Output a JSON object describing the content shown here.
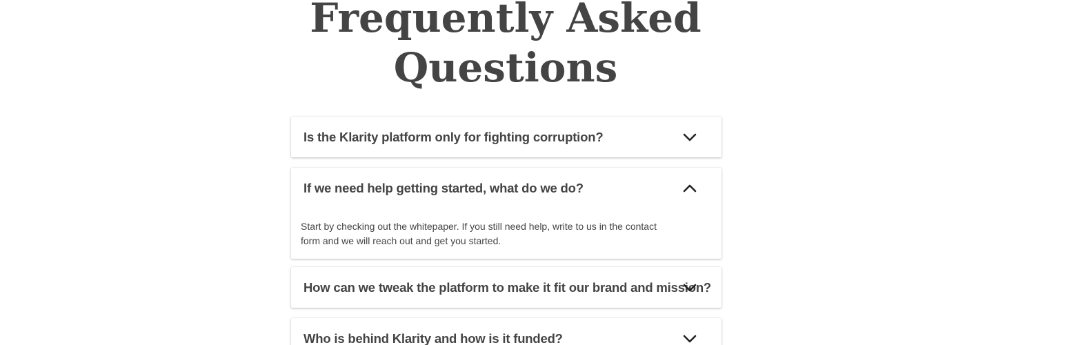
{
  "heading": {
    "line1": "Frequently Asked",
    "line2": "Questions"
  },
  "faqs": [
    {
      "question": "Is the Klarity platform only for fighting corruption?",
      "expanded": false,
      "toggle_icon": "chevron-down-icon"
    },
    {
      "question": "If we need help getting started, what do we do?",
      "answer": "Start by checking out the whitepaper. If you still need help, write to us in the contact form and we will reach out and get you started.",
      "expanded": true,
      "toggle_icon": "chevron-up-icon"
    },
    {
      "question": "How can we tweak the platform to make it fit our brand and mission?",
      "expanded": false,
      "toggle_icon": "chevron-down-icon"
    },
    {
      "question": "Who is behind Klarity and how is it funded?",
      "expanded": false,
      "toggle_icon": "chevron-down-icon"
    }
  ],
  "colors": {
    "text": "#444444",
    "icon": "#222222",
    "card_background": "#ffffff"
  }
}
